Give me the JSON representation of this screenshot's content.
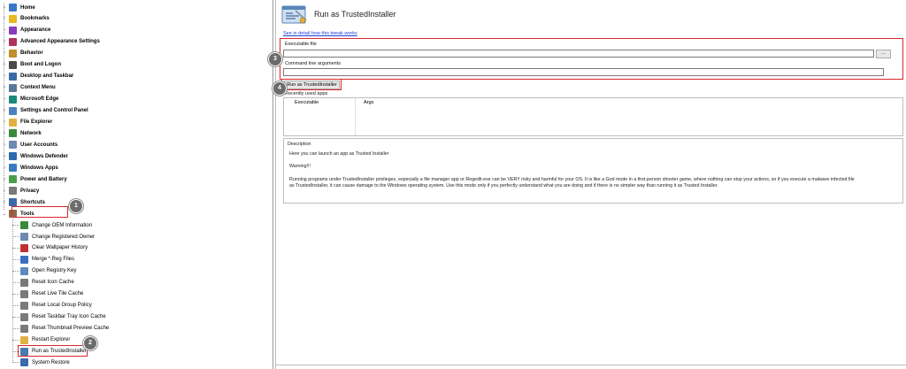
{
  "tree": {
    "items": [
      {
        "label": "Home",
        "icon": "home-icon",
        "color": "#3a78c8"
      },
      {
        "label": "Bookmarks",
        "icon": "star-icon",
        "color": "#e8b820"
      },
      {
        "label": "Appearance",
        "icon": "paint-brush-icon",
        "color": "#8a3cc0"
      },
      {
        "label": "Advanced Appearance Settings",
        "icon": "paint-palette-icon",
        "color": "#b03060"
      },
      {
        "label": "Behavior",
        "icon": "behavior-icon",
        "color": "#c0902a"
      },
      {
        "label": "Boot and Logon",
        "icon": "boot-icon",
        "color": "#4a4a4a"
      },
      {
        "label": "Desktop and Taskbar",
        "icon": "desktop-icon",
        "color": "#3a6aa8"
      },
      {
        "label": "Context Menu",
        "icon": "context-menu-icon",
        "color": "#5a7a9a"
      },
      {
        "label": "Microsoft Edge",
        "icon": "edge-icon",
        "color": "#1b8a7a"
      },
      {
        "label": "Settings and Control Panel",
        "icon": "control-panel-icon",
        "color": "#4a80c0"
      },
      {
        "label": "File Explorer",
        "icon": "folder-icon",
        "color": "#e0b040"
      },
      {
        "label": "Network",
        "icon": "network-icon",
        "color": "#3a8a3a"
      },
      {
        "label": "User Accounts",
        "icon": "users-icon",
        "color": "#6a8ab0"
      },
      {
        "label": "Windows Defender",
        "icon": "shield-icon",
        "color": "#2a6ab0"
      },
      {
        "label": "Windows Apps",
        "icon": "apps-icon",
        "color": "#3a7ac0"
      },
      {
        "label": "Power and Battery",
        "icon": "battery-icon",
        "color": "#4aa04a"
      },
      {
        "label": "Privacy",
        "icon": "privacy-icon",
        "color": "#7a7a7a"
      },
      {
        "label": "Shortcuts",
        "icon": "shortcut-icon",
        "color": "#3a6aa8"
      },
      {
        "label": "Tools",
        "icon": "tools-icon",
        "color": "#8a6a4a"
      }
    ],
    "tools_children": [
      {
        "label": "Change OEM Information",
        "icon": "oem-icon",
        "color": "#3a8a3a"
      },
      {
        "label": "Change Registered Owner",
        "icon": "owner-icon",
        "color": "#6a8ab0"
      },
      {
        "label": "Clear Wallpaper History",
        "icon": "wallpaper-icon",
        "color": "#c03030"
      },
      {
        "label": "Merge *.Reg Files",
        "icon": "merge-icon",
        "color": "#3a70c0"
      },
      {
        "label": "Open Registry Key",
        "icon": "registry-icon",
        "color": "#5a8ac0"
      },
      {
        "label": "Reset Icon Cache",
        "icon": "reset-icon",
        "color": "#7a7a7a"
      },
      {
        "label": "Reset Live Tile Cache",
        "icon": "reset-icon",
        "color": "#7a7a7a"
      },
      {
        "label": "Reset Local Group Policy",
        "icon": "reset-icon",
        "color": "#7a7a7a"
      },
      {
        "label": "Reset Taskbar Tray Icon Cache",
        "icon": "reset-icon",
        "color": "#7a7a7a"
      },
      {
        "label": "Reset Thumbnail Preview Cache",
        "icon": "reset-icon",
        "color": "#7a7a7a"
      },
      {
        "label": "Restart Explorer",
        "icon": "restart-icon",
        "color": "#e0b040"
      },
      {
        "label": "Run as TrustedInstaller",
        "icon": "trustedinstaller-icon",
        "color": "#4a7ab0"
      },
      {
        "label": "System Restore",
        "icon": "system-restore-icon",
        "color": "#3a6aa8"
      }
    ]
  },
  "pane": {
    "title": "Run as TrustedInstaller",
    "detail_link": "See in detail how this tweak works",
    "executable_label": "Executable file",
    "executable_value": "",
    "browse_label": "...",
    "args_label": "Command line arguments",
    "args_value": "",
    "run_button": "Run as TrustedInstaller",
    "recent_label": "Recently used apps",
    "recent_columns": [
      "Executable",
      "Args"
    ],
    "description_label": "Description",
    "description_lines": [
      "Here you can launch an app as Trusted Installer",
      "Warning!!!",
      "Running programs under TrustedInstaller privileges, especially a file manager app or Regedit.exe can be VERY risky and harmful for your OS. It is like a God mode in a first-person shooter game, where nothing can stop your actions, so if you execute a malware infected file",
      "as TrustedInstaller, it can cause damage to the Windows operating system. Use this mode only if you perfectly understand what you are doing and if there is no simpler way than running it as Trusted Installer."
    ]
  },
  "annotations": {
    "badges": [
      "1",
      "2",
      "3",
      "4"
    ],
    "highlight_color": "#d9262c"
  }
}
